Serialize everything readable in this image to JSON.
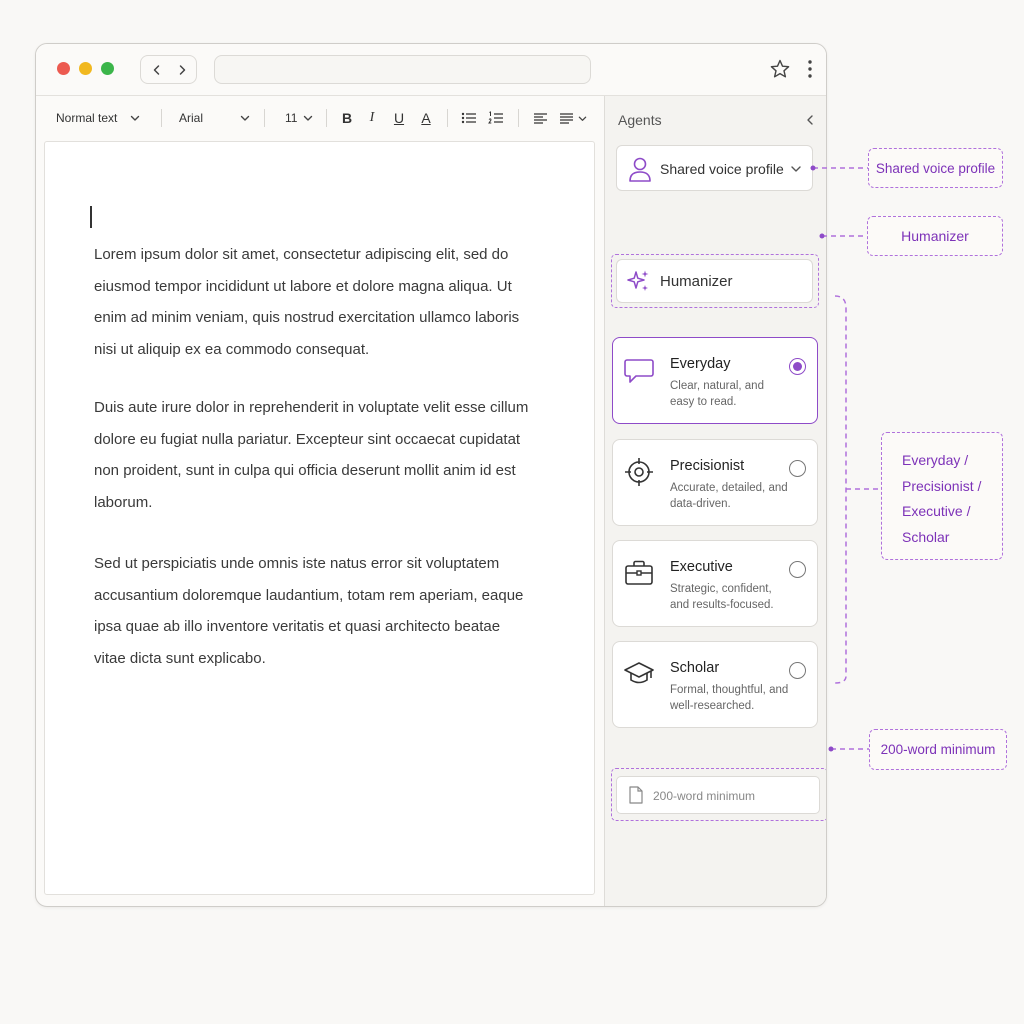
{
  "toolbar": {
    "style_select": "Normal text",
    "font_select": "Arial",
    "size_select": "11",
    "bold_label": "B",
    "italic_label": "I",
    "underline_label": "U",
    "text_color_label": "A"
  },
  "document": {
    "paragraphs": [
      "Lorem ipsum dolor sit amet, consectetur adipiscing elit, sed do eiusmod tempor incididunt ut labore et dolore magna aliqua. Ut enim ad minim veniam, quis nostrud exercitation ullamco laboris nisi ut aliquip ex ea commodo consequat.",
      "Duis aute irure dolor in reprehenderit in voluptate velit esse cillum dolore eu fugiat nulla pariatur. Excepteur sint occaecat cupidatat non proident, sunt in culpa qui officia deserunt mollit anim id est laborum.",
      "Sed ut perspiciatis unde omnis iste natus error sit voluptatem accusantium doloremque laudantium, totam rem aperiam, eaque ipsa quae ab illo inventore veritatis et quasi architecto beatae vitae dicta sunt explicabo."
    ]
  },
  "sidebar": {
    "title": "Agents",
    "voice_profile": "Shared voice profile",
    "humanizer": "Humanizer",
    "agents": [
      {
        "name": "Everyday",
        "description": "Clear, natural, and easy to read.",
        "icon": "speech-bubble-icon",
        "selected": true
      },
      {
        "name": "Precisionist",
        "description": "Accurate, detailed, and data-driven.",
        "icon": "crosshair-icon",
        "selected": false
      },
      {
        "name": "Executive",
        "description": "Strategic, confident, and results-focused.",
        "icon": "briefcase-icon",
        "selected": false
      },
      {
        "name": "Scholar",
        "description": "Formal, thoughtful, and well-researched.",
        "icon": "graduation-cap-icon",
        "selected": false
      }
    ],
    "word_minimum": "200-word minimum"
  },
  "callouts": {
    "voice_profile": "Shared voice profile",
    "humanizer": "Humanizer",
    "agents_lines": [
      "Everyday /",
      "Precisionist /",
      "Executive /",
      "Scholar"
    ],
    "word_minimum": "200-word minimum"
  },
  "colors": {
    "accent": "#8e4bc8",
    "callout_border": "#b071dc",
    "callout_text": "#7d32b8"
  }
}
